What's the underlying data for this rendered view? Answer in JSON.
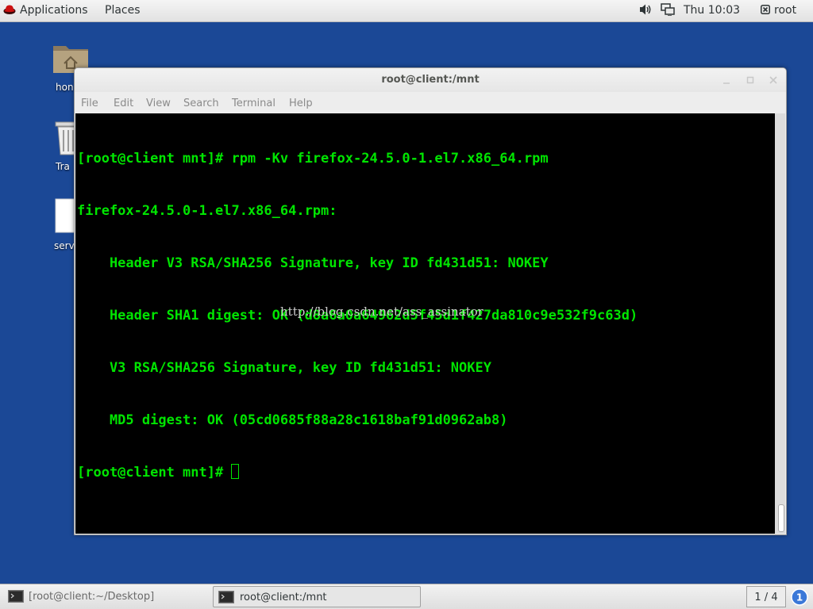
{
  "top_panel": {
    "applications_label": "Applications",
    "places_label": "Places",
    "clock": "Thu 10:03",
    "user": "root"
  },
  "desktop_icons": [
    {
      "label": "hon",
      "icon": "home-folder-icon"
    },
    {
      "label": "Tra",
      "icon": "trash-icon"
    },
    {
      "label": "serv",
      "icon": "file-icon"
    }
  ],
  "window": {
    "title": "root@client:/mnt",
    "menu": [
      "File",
      "Edit",
      "View",
      "Search",
      "Terminal",
      "Help"
    ]
  },
  "terminal": {
    "lines": [
      "[root@client mnt]# rpm -Kv firefox-24.5.0-1.el7.x86_64.rpm",
      "firefox-24.5.0-1.el7.x86_64.rpm:",
      "    Header V3 RSA/SHA256 Signature, key ID fd431d51: NOKEY",
      "    Header SHA1 digest: OK (d8a6a0a64962d5f45d1f427da810c9e532f9c63d)",
      "    V3 RSA/SHA256 Signature, key ID fd431d51: NOKEY",
      "    MD5 digest: OK (05cd0685f88a28c1618baf91d0962ab8)"
    ],
    "prompt": "[root@client mnt]# ",
    "watermark": "http://blog.csdn.net/ass_assinator"
  },
  "taskbar": {
    "items": [
      {
        "label": "[root@client:~/Desktop]",
        "active": false
      },
      {
        "label": "root@client:/mnt",
        "active": true
      }
    ],
    "workspace": "1 / 4",
    "notification_count": "1"
  },
  "colors": {
    "desktop_bg": "#1b4896",
    "terminal_bg": "#000000",
    "terminal_fg": "#00e500",
    "notification_blue": "#3b78d8"
  }
}
